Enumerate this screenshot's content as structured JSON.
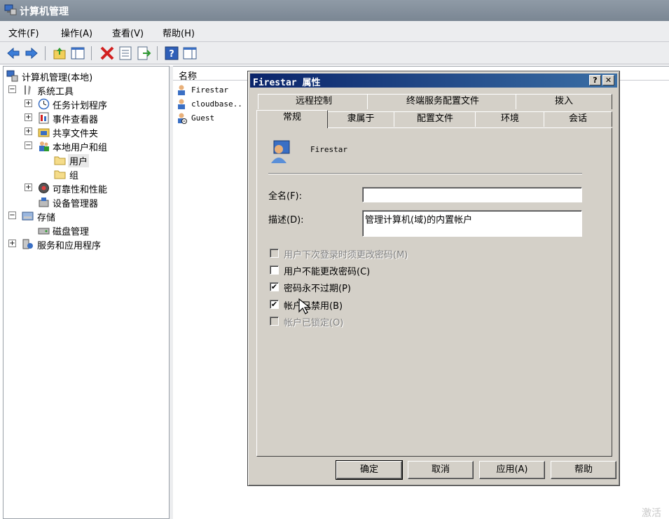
{
  "window": {
    "title": "计算机管理"
  },
  "menu": [
    "文件(F)",
    "操作(A)",
    "查看(V)",
    "帮助(H)"
  ],
  "tree": [
    {
      "label": "计算机管理(本地)",
      "icon": "computer-management-icon",
      "expander": ""
    },
    {
      "label": "系统工具",
      "icon": "tools-icon",
      "expander": "−"
    },
    {
      "label": "任务计划程序",
      "icon": "clock-icon",
      "expander": "+"
    },
    {
      "label": "事件查看器",
      "icon": "event-viewer-icon",
      "expander": "+"
    },
    {
      "label": "共享文件夹",
      "icon": "shared-folder-icon",
      "expander": "+"
    },
    {
      "label": "本地用户和组",
      "icon": "users-groups-icon",
      "expander": "−"
    },
    {
      "label": "用户",
      "icon": "folder-icon",
      "expander": ""
    },
    {
      "label": "组",
      "icon": "folder-icon",
      "expander": ""
    },
    {
      "label": "可靠性和性能",
      "icon": "performance-icon",
      "expander": "+"
    },
    {
      "label": "设备管理器",
      "icon": "device-manager-icon",
      "expander": ""
    },
    {
      "label": "存储",
      "icon": "storage-icon",
      "expander": "−"
    },
    {
      "label": "磁盘管理",
      "icon": "disk-icon",
      "expander": ""
    },
    {
      "label": "服务和应用程序",
      "icon": "services-icon",
      "expander": "+"
    }
  ],
  "list": {
    "header": "名称",
    "rows": [
      "Firestar",
      "cloudbase..",
      "Guest"
    ]
  },
  "watermark": "激活",
  "dialog": {
    "title": "Firestar 属性",
    "help_btn": "?",
    "close_btn": "✕",
    "tabs_back": [
      "远程控制",
      "终端服务配置文件",
      "拨入"
    ],
    "tabs_front": [
      "常规",
      "隶属于",
      "配置文件",
      "环境",
      "会话"
    ],
    "username": "Firestar",
    "fullname_label": "全名(F):",
    "fullname_value": "",
    "desc_label": "描述(D):",
    "desc_value": "管理计算机(域)的内置帐户",
    "checkboxes": [
      {
        "label": "用户下次登录时须更改密码(M)",
        "checked": false,
        "disabled": true
      },
      {
        "label": "用户不能更改密码(C)",
        "checked": false,
        "disabled": false
      },
      {
        "label": "密码永不过期(P)",
        "checked": true,
        "disabled": false
      },
      {
        "label": "帐户已禁用(B)",
        "checked": true,
        "disabled": false
      },
      {
        "label": "帐户已锁定(O)",
        "checked": false,
        "disabled": true
      }
    ],
    "buttons": [
      "确定",
      "取消",
      "应用(A)",
      "帮助"
    ]
  }
}
